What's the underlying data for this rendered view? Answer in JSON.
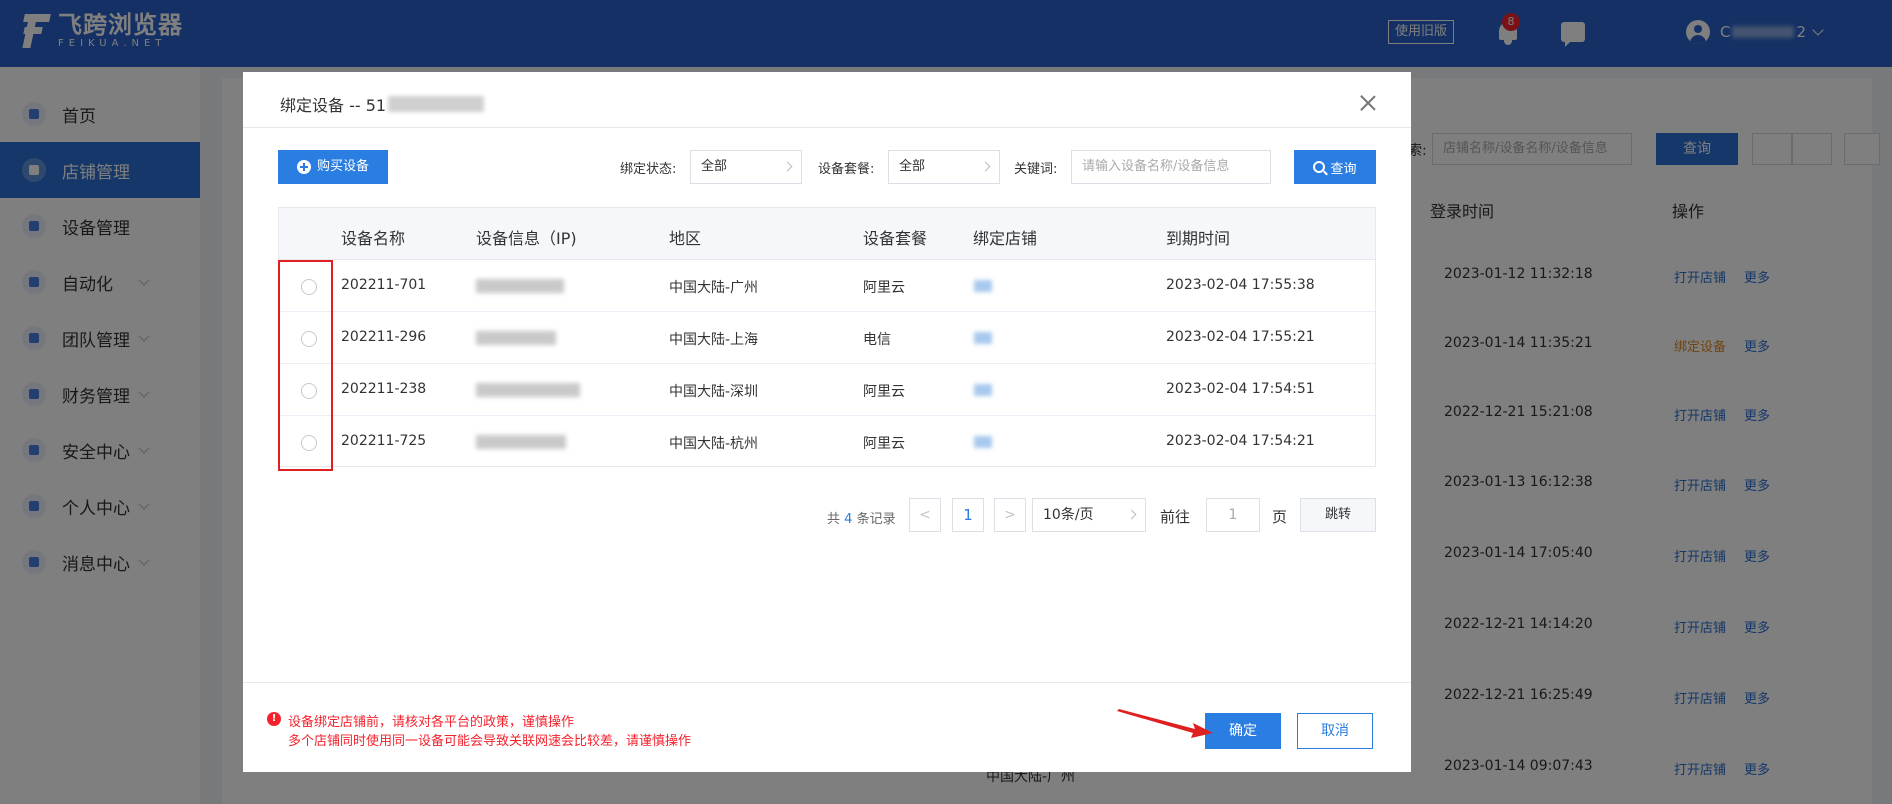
{
  "app": {
    "logo_name": "飞跨浏览器",
    "logo_sub": "FEIKUA.NET",
    "old_version_label": "使用旧版",
    "notification_count": "8",
    "username_start": "C",
    "username_end": "2"
  },
  "sidebar": {
    "items": [
      {
        "label": "首页",
        "icon": "home-icon",
        "active": false,
        "expandable": false
      },
      {
        "label": "店铺管理",
        "icon": "shop-icon",
        "active": true,
        "expandable": false
      },
      {
        "label": "设备管理",
        "icon": "device-icon",
        "active": false,
        "expandable": false
      },
      {
        "label": "自动化",
        "icon": "robot-icon",
        "active": false,
        "expandable": true
      },
      {
        "label": "团队管理",
        "icon": "team-icon",
        "active": false,
        "expandable": true
      },
      {
        "label": "财务管理",
        "icon": "wallet-icon",
        "active": false,
        "expandable": true
      },
      {
        "label": "安全中心",
        "icon": "shield-icon",
        "active": false,
        "expandable": true
      },
      {
        "label": "个人中心",
        "icon": "user-icon",
        "active": false,
        "expandable": true
      },
      {
        "label": "消息中心",
        "icon": "bell-icon",
        "active": false,
        "expandable": true
      }
    ]
  },
  "background": {
    "search_label": "索:",
    "search_placeholder": "店铺名称/设备名称/设备信息",
    "query_label": "查询",
    "col_login_time": "登录时间",
    "col_action": "操作",
    "rows": [
      {
        "time": "2023-01-12 11:32:18",
        "action": "打开店铺",
        "more": "更多"
      },
      {
        "time": "2023-01-14 11:35:21",
        "action": "绑定设备",
        "more": "更多"
      },
      {
        "time": "2022-12-21 15:21:08",
        "action": "打开店铺",
        "more": "更多"
      },
      {
        "time": "2023-01-13 16:12:38",
        "action": "打开店铺",
        "more": "更多"
      },
      {
        "time": "2023-01-14 17:05:40",
        "action": "打开店铺",
        "more": "更多"
      },
      {
        "time": "2022-12-21 14:14:20",
        "action": "打开店铺",
        "more": "更多"
      },
      {
        "time": "2022-12-21 16:25:49",
        "action": "打开店铺",
        "more": "更多"
      },
      {
        "time": "2023-01-14 09:07:43",
        "action": "打开店铺",
        "more": "更多"
      }
    ],
    "footer_text": "中国大陆-广州"
  },
  "modal": {
    "title": "绑定设备 -- 51",
    "buy_button": "购买设备",
    "filters": {
      "bind_status_label": "绑定状态:",
      "bind_status_value": "全部",
      "package_label": "设备套餐:",
      "package_value": "全部",
      "keyword_label": "关键词:",
      "keyword_placeholder": "请输入设备名称/设备信息",
      "query_button": "查询"
    },
    "table": {
      "columns": [
        "设备名称",
        "设备信息（IP)",
        "地区",
        "设备套餐",
        "绑定店铺",
        "到期时间"
      ],
      "rows": [
        {
          "name": "202211-701",
          "region": "中国大陆-广州",
          "package": "阿里云",
          "expire": "2023-02-04 17:55:38"
        },
        {
          "name": "202211-296",
          "region": "中国大陆-上海",
          "package": "电信",
          "expire": "2023-02-04 17:55:21"
        },
        {
          "name": "202211-238",
          "region": "中国大陆-深圳",
          "package": "阿里云",
          "expire": "2023-02-04 17:54:51"
        },
        {
          "name": "202211-725",
          "region": "中国大陆-杭州",
          "package": "阿里云",
          "expire": "2023-02-04 17:54:21"
        }
      ]
    },
    "pagination": {
      "total_prefix": "共",
      "total_count": "4",
      "total_suffix": "条记录",
      "prev": "<",
      "current_page": "1",
      "next": ">",
      "page_size": "10条/页",
      "goto_label": "前往",
      "goto_value": "1",
      "page_unit": "页",
      "jump_button": "跳转"
    },
    "warnings": [
      "设备绑定店铺前，请核对各平台的政策，谨慎操作",
      "多个店铺同时使用同一设备可能会导致关联网速会比较差，请谨慎操作"
    ],
    "confirm_button": "确定",
    "cancel_button": "取消"
  },
  "colors": {
    "primary": "#2a7de1",
    "header": "#2860c8",
    "warning": "#f5222d",
    "highlight_box": "#e02020"
  }
}
